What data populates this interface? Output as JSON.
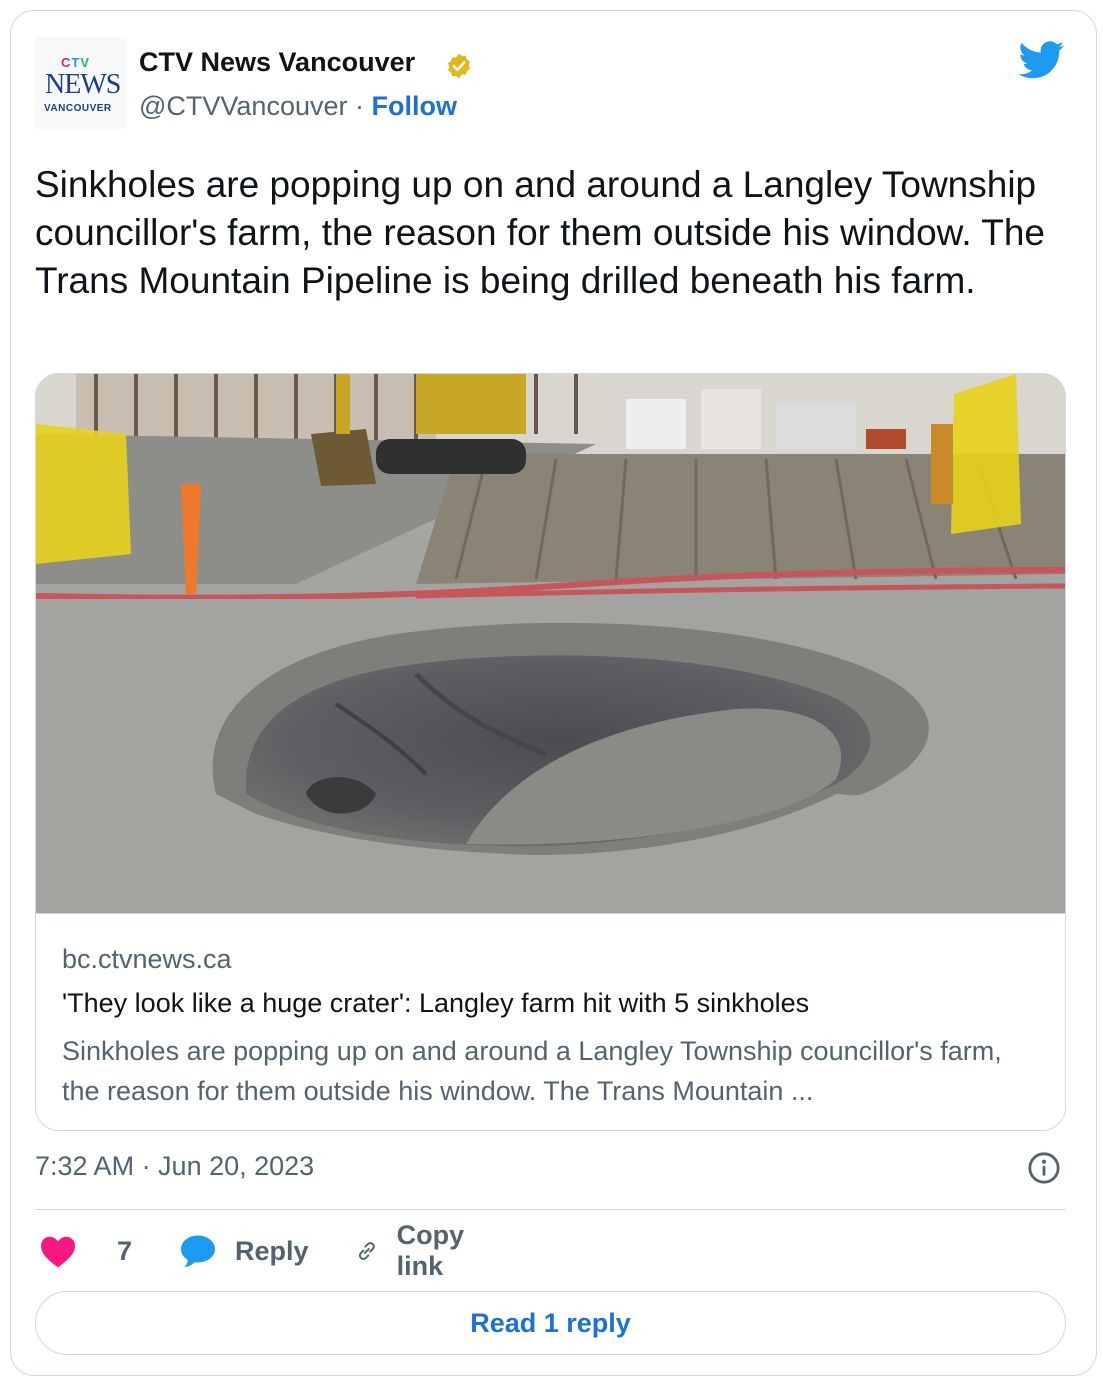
{
  "account": {
    "name": "CTV News Vancouver",
    "handle": "@CTVVancouver",
    "separator": " · ",
    "follow_label": "Follow",
    "avatar_logo": {
      "ctv": "CTV",
      "news": "NEWS",
      "region": "VANCOUVER"
    }
  },
  "tweet": {
    "text": "Sinkholes are popping up on and around a Langley Township councillor's farm, the reason for them outside his window. The Trans Mountain Pipeline is being drilled beneath his farm.",
    "timestamp": "7:32 AM · Jun 20, 2023"
  },
  "link_card": {
    "domain": "bc.ctvnews.ca",
    "title": "'They look like a huge crater': Langley farm hit with 5 sinkholes",
    "description": "Sinkholes are popping up on and around a Langley Township councillor's farm, the reason for them outside his window. The Trans Mountain ..."
  },
  "actions": {
    "like_count": "7",
    "reply_label": "Reply",
    "copy_label": "Copy link"
  },
  "read_reply_label": "Read 1 reply",
  "icons": {
    "verified": "verified-badge-icon",
    "twitter": "twitter-bird-icon",
    "info": "info-icon",
    "like": "heart-icon",
    "reply": "speech-bubble-icon",
    "copy": "link-icon"
  },
  "colors": {
    "brand_blue": "#1d9bf0",
    "link_blue": "#1d70d8",
    "like_pink": "#f91880",
    "verified_gold": "#e2b719",
    "muted_text": "#536471"
  }
}
